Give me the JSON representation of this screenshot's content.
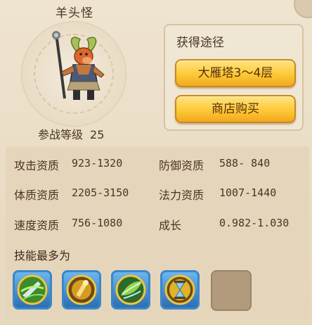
{
  "monster": {
    "name": "羊头怪",
    "level_label": "参战等级",
    "level_value": "25"
  },
  "source": {
    "title": "获得途径",
    "buttons": [
      "大雁塔3～4层",
      "商店购买"
    ]
  },
  "stats": [
    {
      "label": "攻击资质",
      "value": "923-1320"
    },
    {
      "label": "防御资质",
      "value": "588- 840"
    },
    {
      "label": "体质资质",
      "value": "2205-3150"
    },
    {
      "label": "法力资质",
      "value": "1007-1440"
    },
    {
      "label": "速度资质",
      "value": "756-1080"
    },
    {
      "label": "成长",
      "value": "0.982-1.030"
    }
  ],
  "skills": {
    "title": "技能最多为",
    "icons": [
      "wind-slash-icon",
      "golden-bell-icon",
      "green-leaf-icon",
      "hourglass-icon",
      "empty-slot"
    ]
  }
}
